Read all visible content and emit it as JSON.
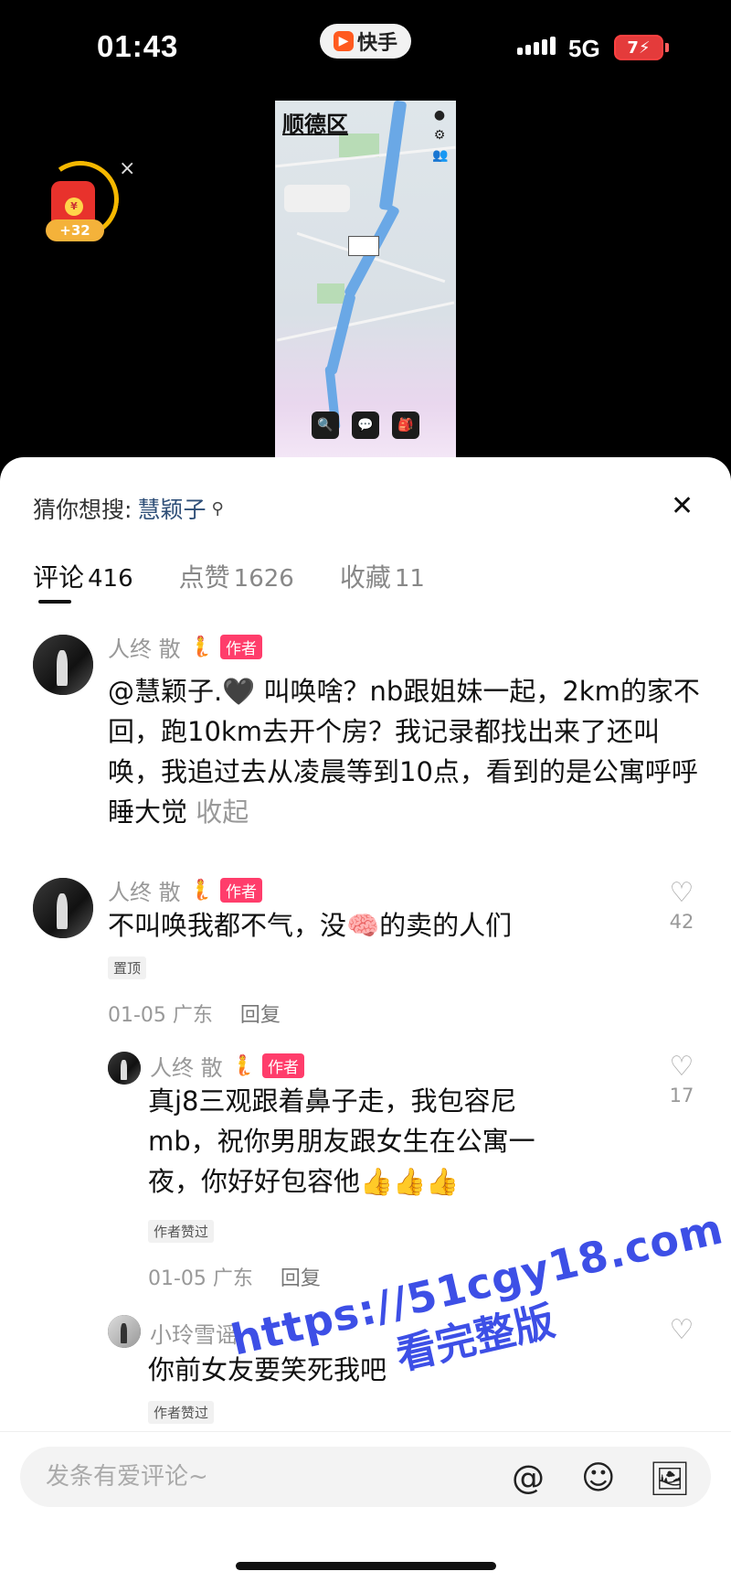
{
  "status_bar": {
    "time": "01:43",
    "network": "5G",
    "battery": "7"
  },
  "app": {
    "name": "快手"
  },
  "red_packet": {
    "bonus": "+32",
    "close": "×"
  },
  "map": {
    "district": "顺德区"
  },
  "search_hint": {
    "prefix": "猜你想搜:",
    "keyword": "慧颖子"
  },
  "tabs": [
    {
      "label": "评论",
      "count": "416"
    },
    {
      "label": "点赞",
      "count": "1626"
    },
    {
      "label": "收藏",
      "count": "11"
    }
  ],
  "comments": [
    {
      "user": "人终  散",
      "author_tag": "作者",
      "text": "@慧颖子.🖤 叫唤啥？nb跟姐妹一起，2km的家不回，跑10km去开个房？我记录都找出来了还叫唤，我追过去从凌晨等到10点，看到的是公寓呼呼睡大觉",
      "collapse": "收起"
    },
    {
      "user": "人终  散",
      "author_tag": "作者",
      "text": "不叫唤我都不气，没🧠的卖的人们",
      "badge": "置顶",
      "date": "01-05 广东",
      "reply": "回复",
      "likes": "42"
    }
  ],
  "replies": [
    {
      "user": "人终  散",
      "author_tag": "作者",
      "text": "真j8三观跟着鼻子走，我包容尼mb，祝你男朋友跟女生在公寓一夜，你好好包容他👍👍👍",
      "badge": "作者赞过",
      "date": "01-05 广东",
      "reply": "回复",
      "likes": "17"
    },
    {
      "user": "小玲雪谣",
      "text": "你前女友要笑死我吧",
      "badge": "作者赞过"
    }
  ],
  "input": {
    "placeholder": "发条有爱评论~"
  },
  "watermark": {
    "line1": "https://51cgy18.com",
    "line2": "看完整版"
  }
}
